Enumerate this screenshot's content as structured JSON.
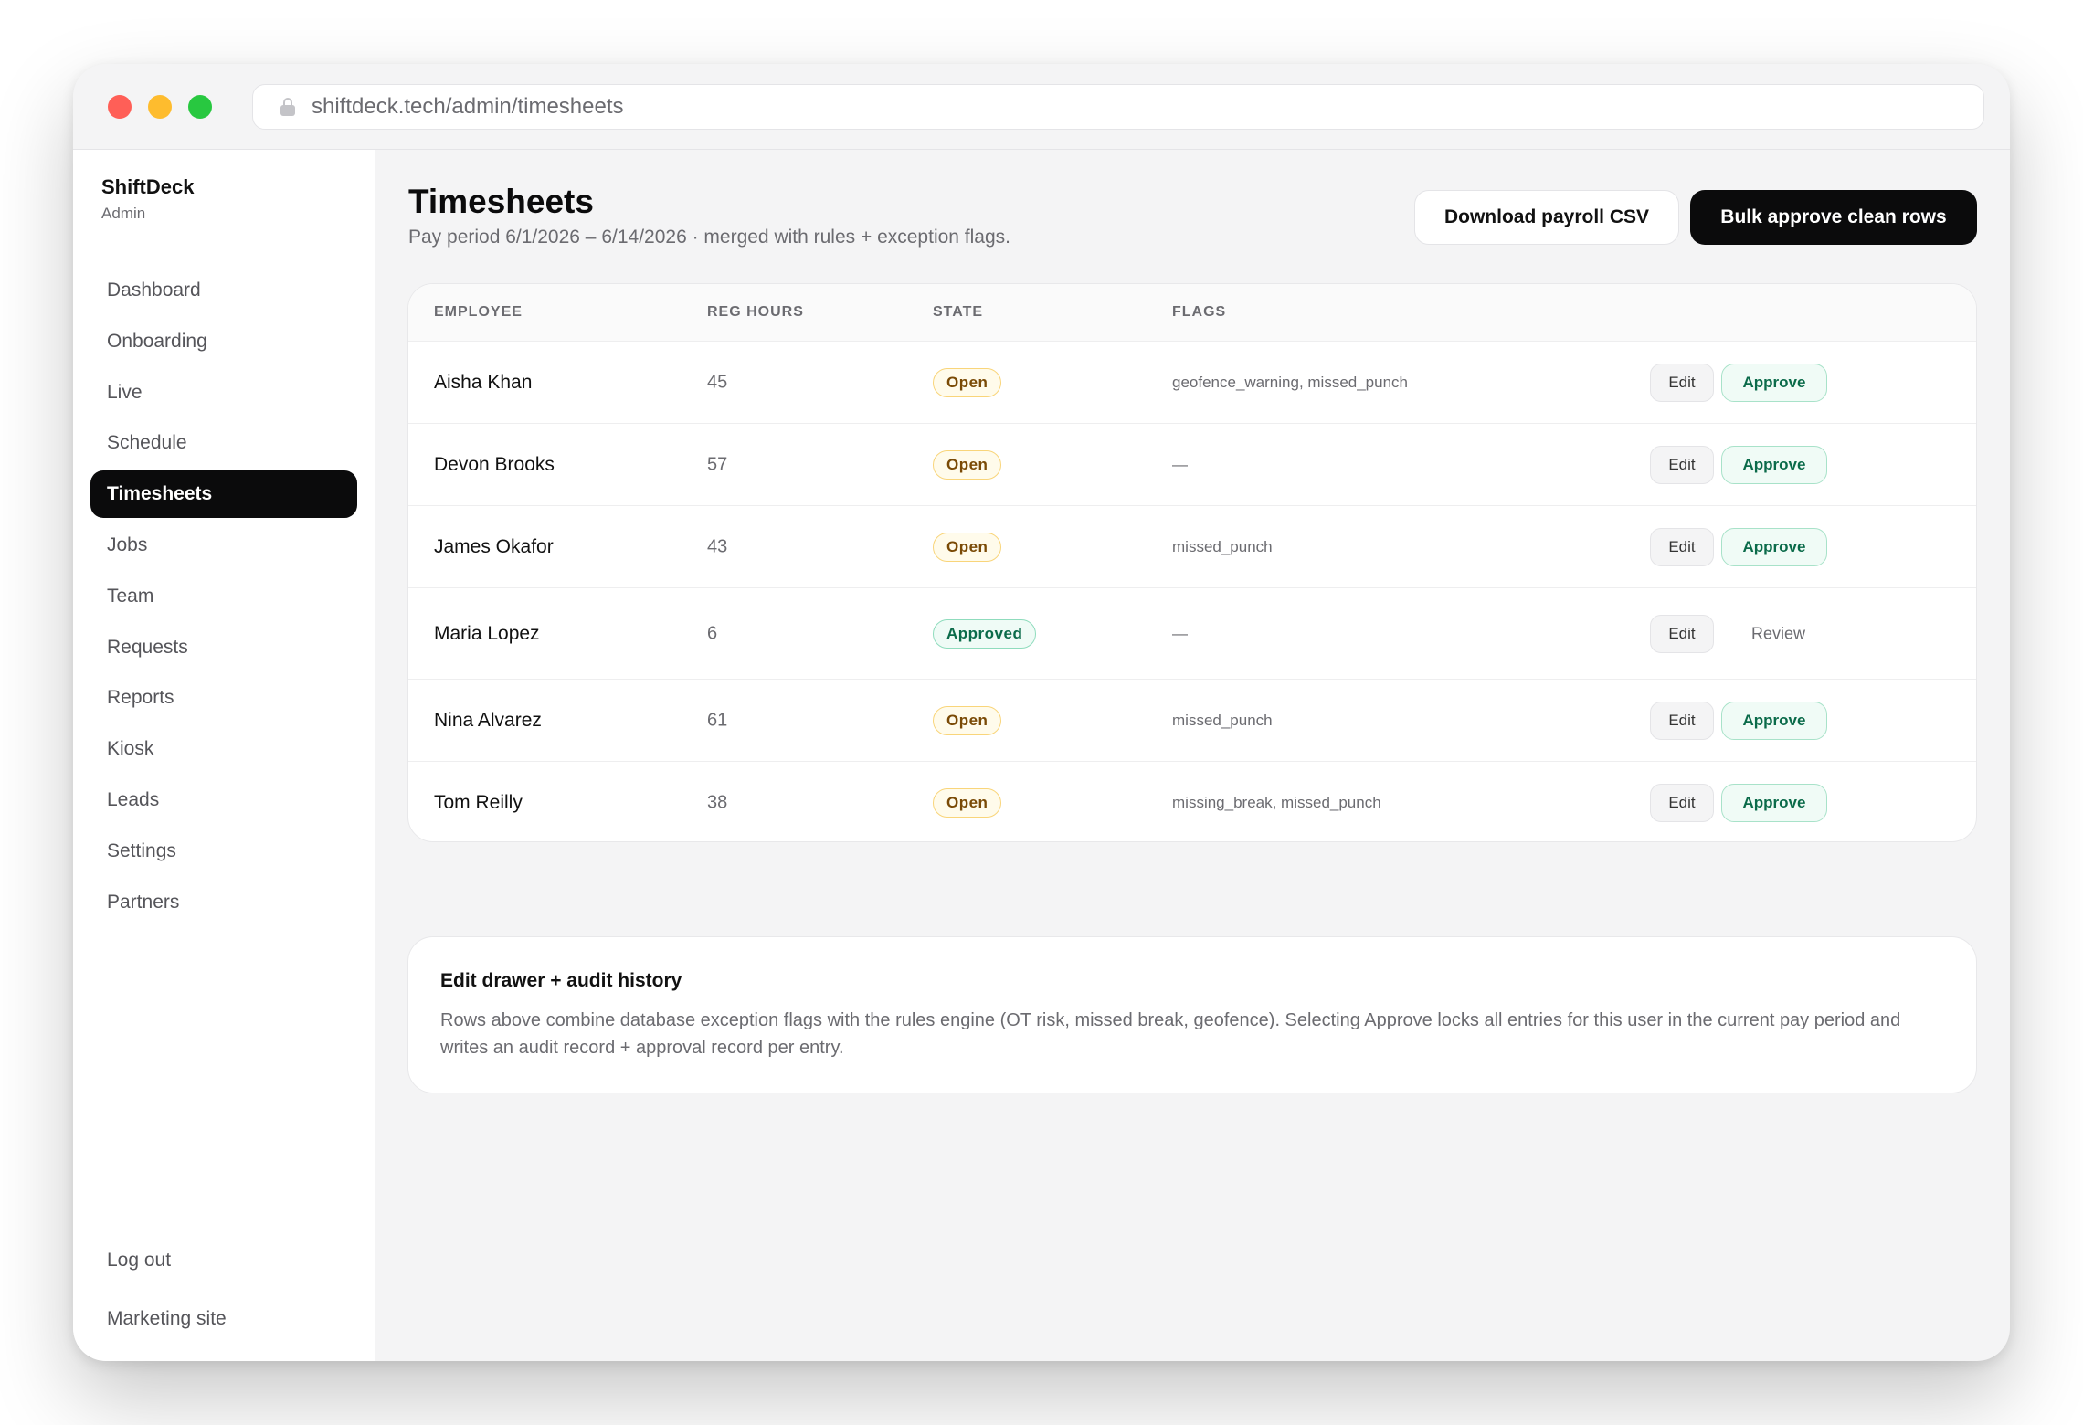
{
  "browser": {
    "url": "shiftdeck.tech/admin/timesheets"
  },
  "brand": {
    "name": "ShiftDeck",
    "subtitle": "Admin"
  },
  "sidebar": {
    "items": [
      {
        "label": "Dashboard"
      },
      {
        "label": "Onboarding"
      },
      {
        "label": "Live"
      },
      {
        "label": "Schedule"
      },
      {
        "label": "Timesheets",
        "active": true
      },
      {
        "label": "Jobs"
      },
      {
        "label": "Team"
      },
      {
        "label": "Requests"
      },
      {
        "label": "Reports"
      },
      {
        "label": "Kiosk"
      },
      {
        "label": "Leads"
      },
      {
        "label": "Settings"
      },
      {
        "label": "Partners"
      }
    ],
    "bottom": {
      "logout": "Log out",
      "marketing": "Marketing site"
    }
  },
  "page": {
    "title": "Timesheets",
    "subtitle": "Pay period 6/1/2026 – 6/14/2026 · merged with rules + exception flags.",
    "download_label": "Download payroll CSV",
    "bulk_label": "Bulk approve clean rows"
  },
  "table": {
    "headers": {
      "employee": "EMPLOYEE",
      "hours": "REG HOURS",
      "state": "STATE",
      "flags": "FLAGS"
    },
    "rows": [
      {
        "employee": "Aisha Khan",
        "hours": "45",
        "state": "Open",
        "flags": "geofence_warning, missed_punch",
        "edit": "Edit",
        "action": "Approve"
      },
      {
        "employee": "Devon Brooks",
        "hours": "57",
        "state": "Open",
        "flags": "—",
        "edit": "Edit",
        "action": "Approve"
      },
      {
        "employee": "James Okafor",
        "hours": "43",
        "state": "Open",
        "flags": "missed_punch",
        "edit": "Edit",
        "action": "Approve"
      },
      {
        "employee": "Maria Lopez",
        "hours": "6",
        "state": "Approved",
        "flags": "—",
        "edit": "Edit",
        "action": "Review"
      },
      {
        "employee": "Nina Alvarez",
        "hours": "61",
        "state": "Open",
        "flags": "missed_punch",
        "edit": "Edit",
        "action": "Approve"
      },
      {
        "employee": "Tom Reilly",
        "hours": "38",
        "state": "Open",
        "flags": "missing_break, missed_punch",
        "edit": "Edit",
        "action": "Approve"
      }
    ]
  },
  "info": {
    "title": "Edit drawer + audit history",
    "body": "Rows above combine database exception flags with the rules engine (OT risk, missed break, geofence). Selecting Approve locks all entries for this user in the current pay period and writes an audit record + approval record per entry."
  },
  "colors": {
    "accent": "#0b0b0c",
    "open_badge": "#fffbeb",
    "approved_badge": "#effbf6",
    "approve_text": "#0b6b4a"
  }
}
